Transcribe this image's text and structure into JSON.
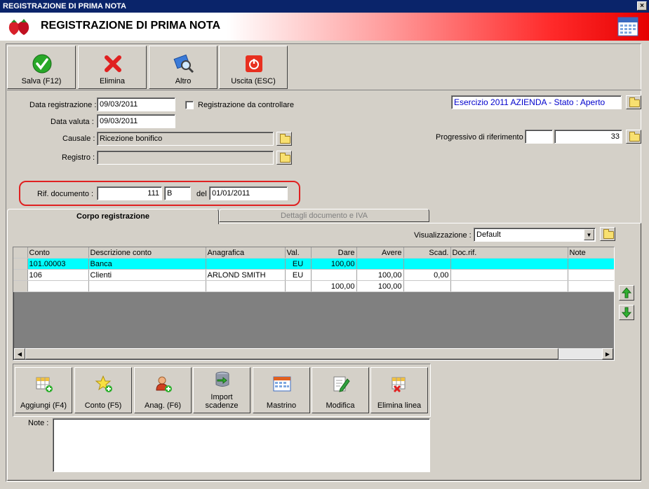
{
  "window": {
    "title": "REGISTRAZIONE DI PRIMA NOTA",
    "close": "×"
  },
  "header": {
    "title": "REGISTRAZIONE DI PRIMA NOTA"
  },
  "toolbar": {
    "save_label": "Salva (F12)",
    "delete_label": "Elimina",
    "other_label": "Altro",
    "exit_label": "Uscita (ESC)"
  },
  "form": {
    "data_registrazione_label": "Data registrazione :",
    "data_registrazione": "09/03/2011",
    "da_controllare_label": "Registrazione da controllare",
    "data_valuta_label": "Data valuta :",
    "data_valuta": "09/03/2011",
    "causale_label": "Causale :",
    "causale": "Ricezione bonifico",
    "registro_label": "Registro :",
    "registro": "",
    "esercizio": "Esercizio 2011 AZIENDA - Stato : Aperto",
    "progressivo_label": "Progressivo di riferimento :",
    "progressivo_a": "",
    "progressivo_b": "33",
    "rif_label": "Rif. documento :",
    "rif_numero": "111",
    "rif_serie": "B",
    "del_label": "del",
    "rif_data": "01/01/2011"
  },
  "tabs": {
    "active": "Corpo registrazione",
    "other": "Dettagli documento e IVA"
  },
  "view": {
    "label": "Visualizzazione :",
    "value": "Default"
  },
  "table": {
    "headers": [
      "Conto",
      "Descrizione conto",
      "Anagrafica",
      "Val.",
      "Dare",
      "Avere",
      "Scad.",
      "Doc.rif.",
      "Note"
    ],
    "rows": [
      [
        "101.00003",
        "Banca",
        "",
        "EU",
        "100,00",
        "",
        "",
        "",
        ""
      ],
      [
        "106",
        "Clienti",
        "ARLOND SMITH",
        "EU",
        "",
        "100,00",
        "0,00",
        "",
        ""
      ],
      [
        "",
        "",
        "",
        "",
        "100,00",
        "100,00",
        "",
        "",
        ""
      ]
    ]
  },
  "actions": {
    "aggiungi": "Aggiungi (F4)",
    "conto": "Conto (F5)",
    "anag": "Anag. (F6)",
    "import_1": "Import",
    "import_2": "scadenze",
    "mastrino": "Mastrino",
    "modifica": "Modifica",
    "elimina_linea": "Elimina linea"
  },
  "note": {
    "label": "Note :",
    "value": ""
  },
  "colors": {
    "selected_row": "#00ffff",
    "accent": "#0a246a",
    "highlight_border": "#e02020",
    "link_blue": "#0000cc"
  }
}
